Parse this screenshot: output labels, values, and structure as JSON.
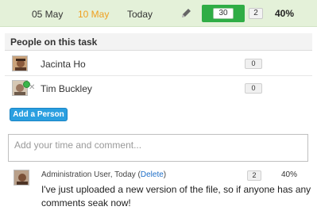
{
  "task": {
    "start_date": "05 May",
    "due_date": "10 May",
    "today_label": "Today",
    "edit_icon": "pencil-icon",
    "estimated_hours": "30",
    "hours_spent": "2",
    "percent_complete": "40%",
    "colors": {
      "row_bg": "#e4f1d9",
      "due": "#f0a020",
      "estimate_box": "#2fad45"
    }
  },
  "people": {
    "heading": "People on this task",
    "items": [
      {
        "name": "Jacinta Ho",
        "count": "0"
      },
      {
        "name": "Tim Buckley",
        "count": "0",
        "online": true,
        "remove_icon": "x-icon"
      }
    ],
    "add_button": "Add a Person"
  },
  "comment_box": {
    "placeholder": "Add your time and comment..."
  },
  "comments": [
    {
      "author": "Administration User",
      "date_sep": ", ",
      "date": "Today",
      "delete_open": " (",
      "delete_label": "Delete",
      "delete_close": ")",
      "hours": "2",
      "percent": "40%",
      "text": "I've just uploaded a new version of the file, so if anyone has any comments seak now!"
    }
  ]
}
